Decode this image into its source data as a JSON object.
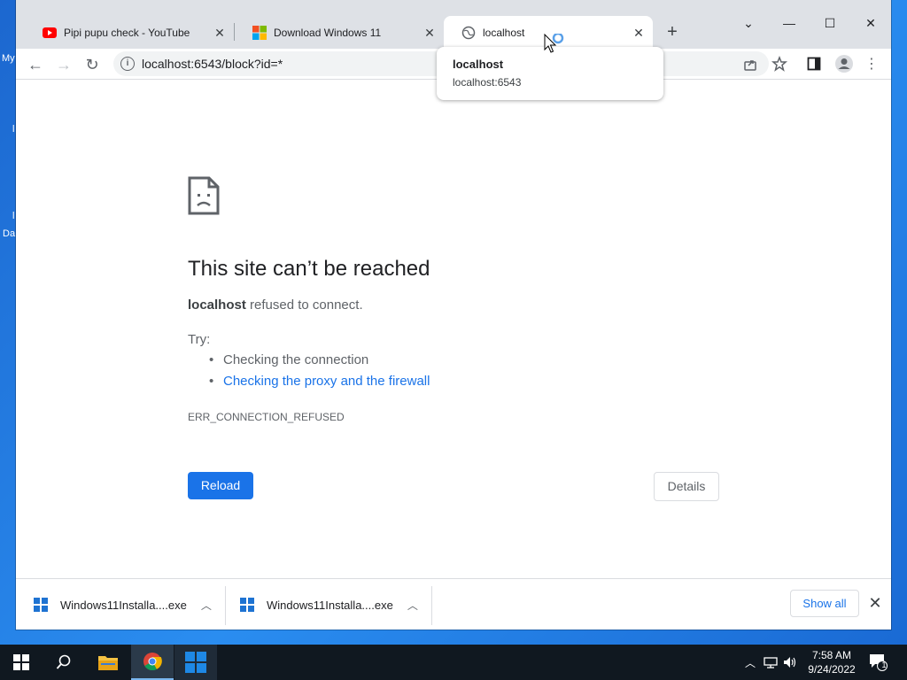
{
  "desktop": {
    "fragments": [
      "My",
      "l",
      "l",
      "Da"
    ]
  },
  "tabs": [
    {
      "title": "Pipi pupu check - YouTube",
      "favicon": "youtube-icon"
    },
    {
      "title": "Download Windows 11",
      "favicon": "microsoft-icon"
    },
    {
      "title": "localhost",
      "favicon": "globe-icon",
      "active": true
    }
  ],
  "window_controls": {
    "tab_search": "⌄",
    "minimize": "—",
    "maximize": "☐",
    "close": "✕"
  },
  "toolbar": {
    "back": "←",
    "forward": "→",
    "reload": "↻",
    "url": "localhost:6543/block?id=*"
  },
  "hovercard": {
    "title": "localhost",
    "subtitle": "localhost:6543"
  },
  "error": {
    "title": "This site can’t be reached",
    "host": "localhost",
    "desc_rest": " refused to connect.",
    "try_label": "Try:",
    "suggestions": [
      "Checking the connection",
      "Checking the proxy and the firewall"
    ],
    "code": "ERR_CONNECTION_REFUSED",
    "reload_label": "Reload",
    "details_label": "Details"
  },
  "downloads": {
    "items": [
      {
        "name": "Windows11Installa....exe"
      },
      {
        "name": "Windows11Installa....exe"
      }
    ],
    "show_all_label": "Show all"
  },
  "taskbar": {
    "time": "7:58 AM",
    "date": "9/24/2022",
    "notification_count": "1"
  },
  "colors": {
    "accent": "#1a73e8",
    "taskbar": "#101820",
    "desktop": "#1c67cf"
  }
}
